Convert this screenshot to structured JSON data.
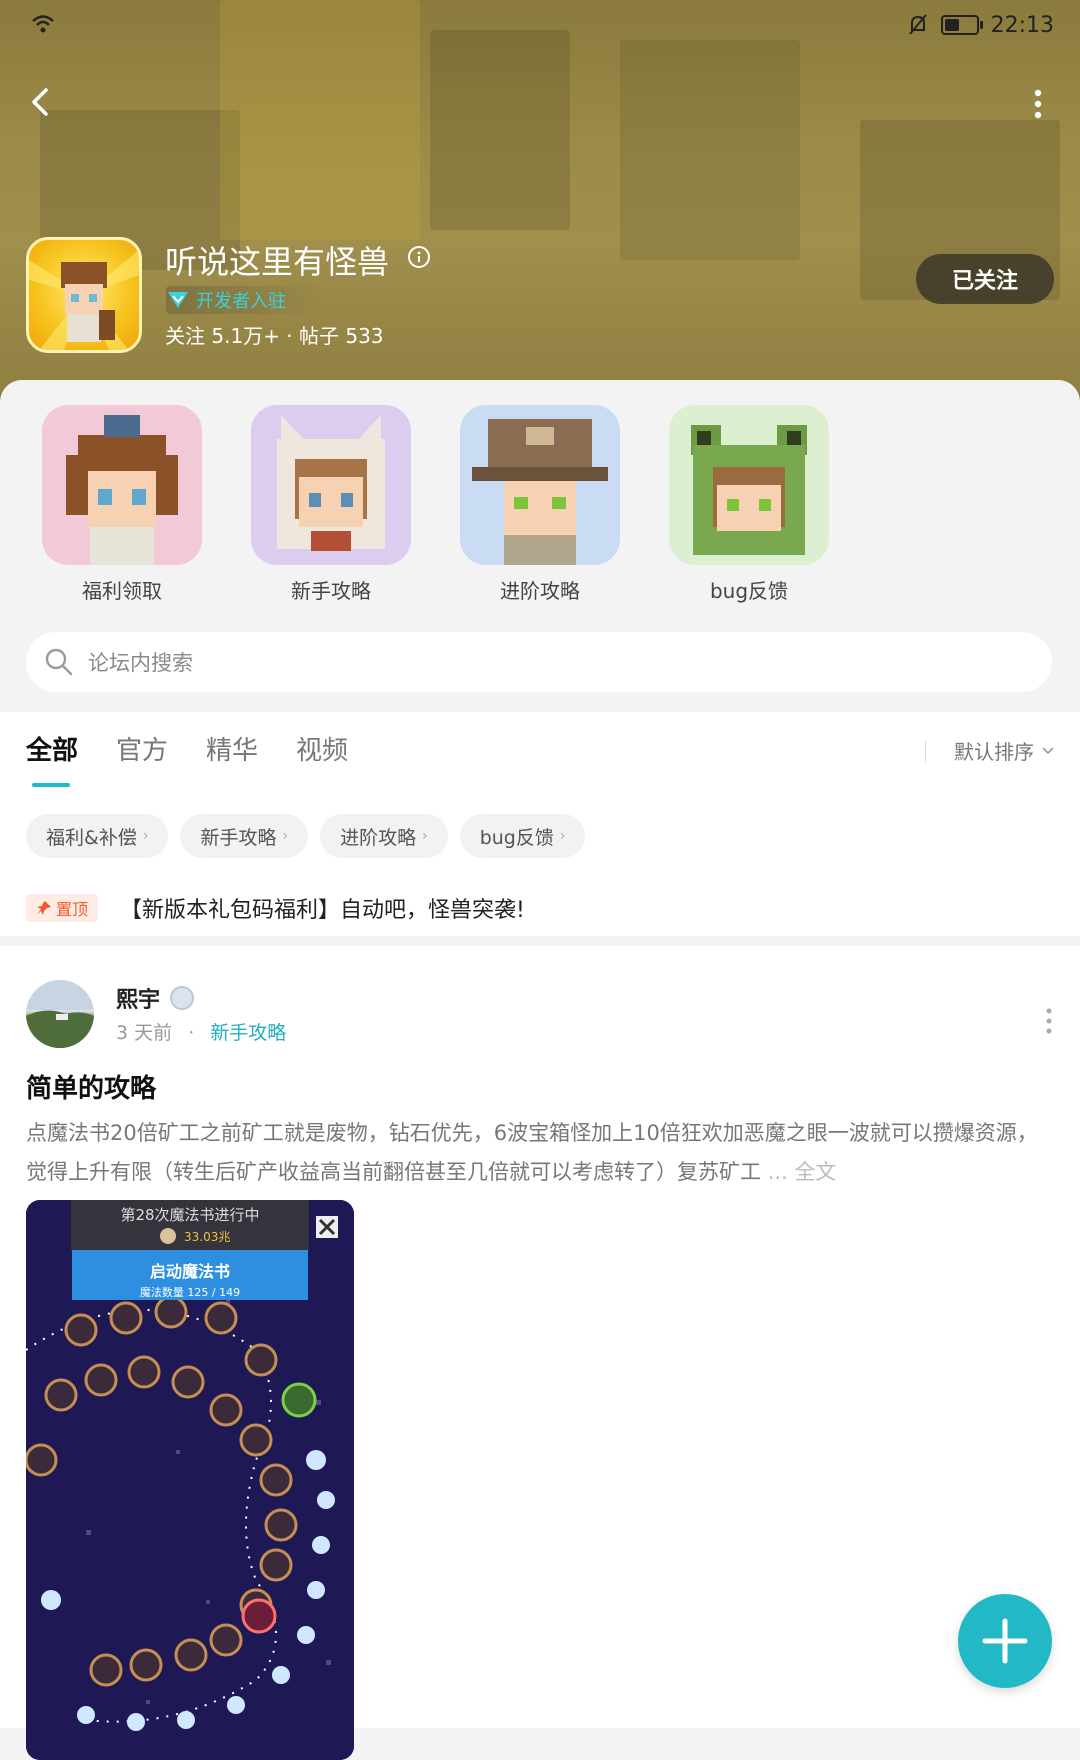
{
  "status_bar": {
    "time": "22:13"
  },
  "header": {
    "title": "听说这里有怪兽",
    "developer_badge": "开发者入驻",
    "stats_text": "关注 5.1万+  ·  帖子 533",
    "follow_button": "已关注"
  },
  "categories": [
    {
      "label": "福利领取",
      "bg": "#f2c9d6"
    },
    {
      "label": "新手攻略",
      "bg": "#dccdf0"
    },
    {
      "label": "进阶攻略",
      "bg": "#c9dcf3"
    },
    {
      "label": "bug反馈",
      "bg": "#dcefd0"
    }
  ],
  "search": {
    "placeholder": "论坛内搜索"
  },
  "tabs": [
    {
      "label": "全部",
      "active": true
    },
    {
      "label": "官方"
    },
    {
      "label": "精华"
    },
    {
      "label": "视频"
    }
  ],
  "sort": {
    "label": "默认排序"
  },
  "chips": [
    "福利&补偿",
    "新手攻略",
    "进阶攻略",
    "bug反馈"
  ],
  "pinned": {
    "badge": "置顶",
    "title": "【新版本礼包码福利】自动吧，怪兽突袭!"
  },
  "post": {
    "author": "熙宇",
    "time": "3 天前",
    "tag": "新手攻略",
    "title": "简单的攻略",
    "body": "点魔法书20倍矿工之前矿工就是废物，钻石优先，6波宝箱怪加上10倍狂欢加恶魔之眼一波就可以攒爆资源，觉得上升有限（转生后矿产收益高当前翻倍甚至几倍就可以考虑转了）复苏矿工",
    "ellipsis": "...",
    "full_text": "全文",
    "screenshot": {
      "header": "第28次魔法书进行中",
      "coins": "33.03兆",
      "button": "启动魔法书",
      "count": "魔法数量 125 / 149"
    }
  },
  "colors": {
    "accent": "#21b9c8",
    "pin": "#f05a30"
  }
}
